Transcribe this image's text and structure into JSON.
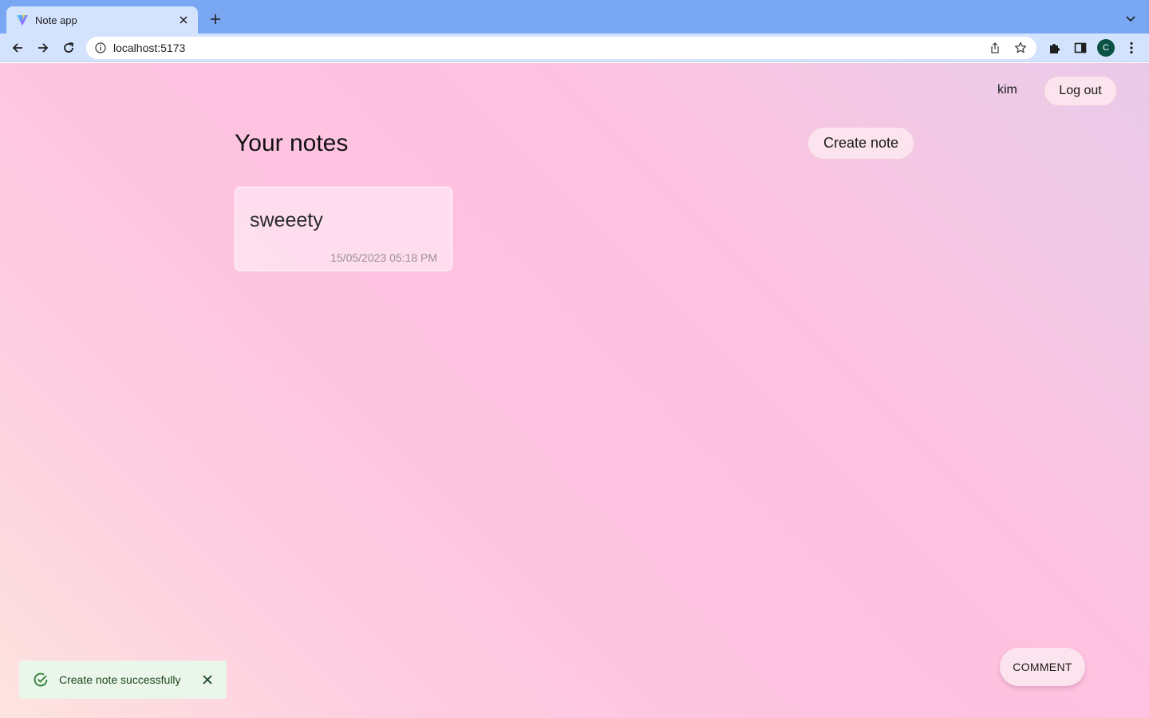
{
  "browser": {
    "tab_title": "Note app",
    "url": "localhost:5173",
    "profile_initial": "C",
    "icons": {
      "favicon": "vite-logo-icon",
      "tab_close": "close-icon",
      "new_tab": "plus-icon",
      "tab_list": "chevron-down-icon",
      "back": "arrow-left-icon",
      "forward": "arrow-right-icon",
      "reload": "reload-icon",
      "site_info": "info-icon",
      "share": "share-icon",
      "bookmark": "star-icon",
      "extensions": "puzzle-icon",
      "side_panel": "side-panel-icon",
      "menu": "kebab-menu-icon"
    }
  },
  "header": {
    "username": "kim",
    "logout_label": "Log out"
  },
  "main": {
    "title": "Your notes",
    "create_label": "Create note",
    "notes": [
      {
        "title": "sweeety",
        "date": "15/05/2023 05:18 PM"
      }
    ]
  },
  "toast": {
    "message": "Create note successfully",
    "icon": "check-circle-icon",
    "color": "#1e7e34"
  },
  "comment_button": {
    "label": "COMMENT"
  },
  "colors": {
    "tab_strip": "#7aa7f2",
    "toolbar": "#d3e3fd",
    "button_bg": "#fce4ef",
    "toast_bg": "#eaf6ea"
  }
}
